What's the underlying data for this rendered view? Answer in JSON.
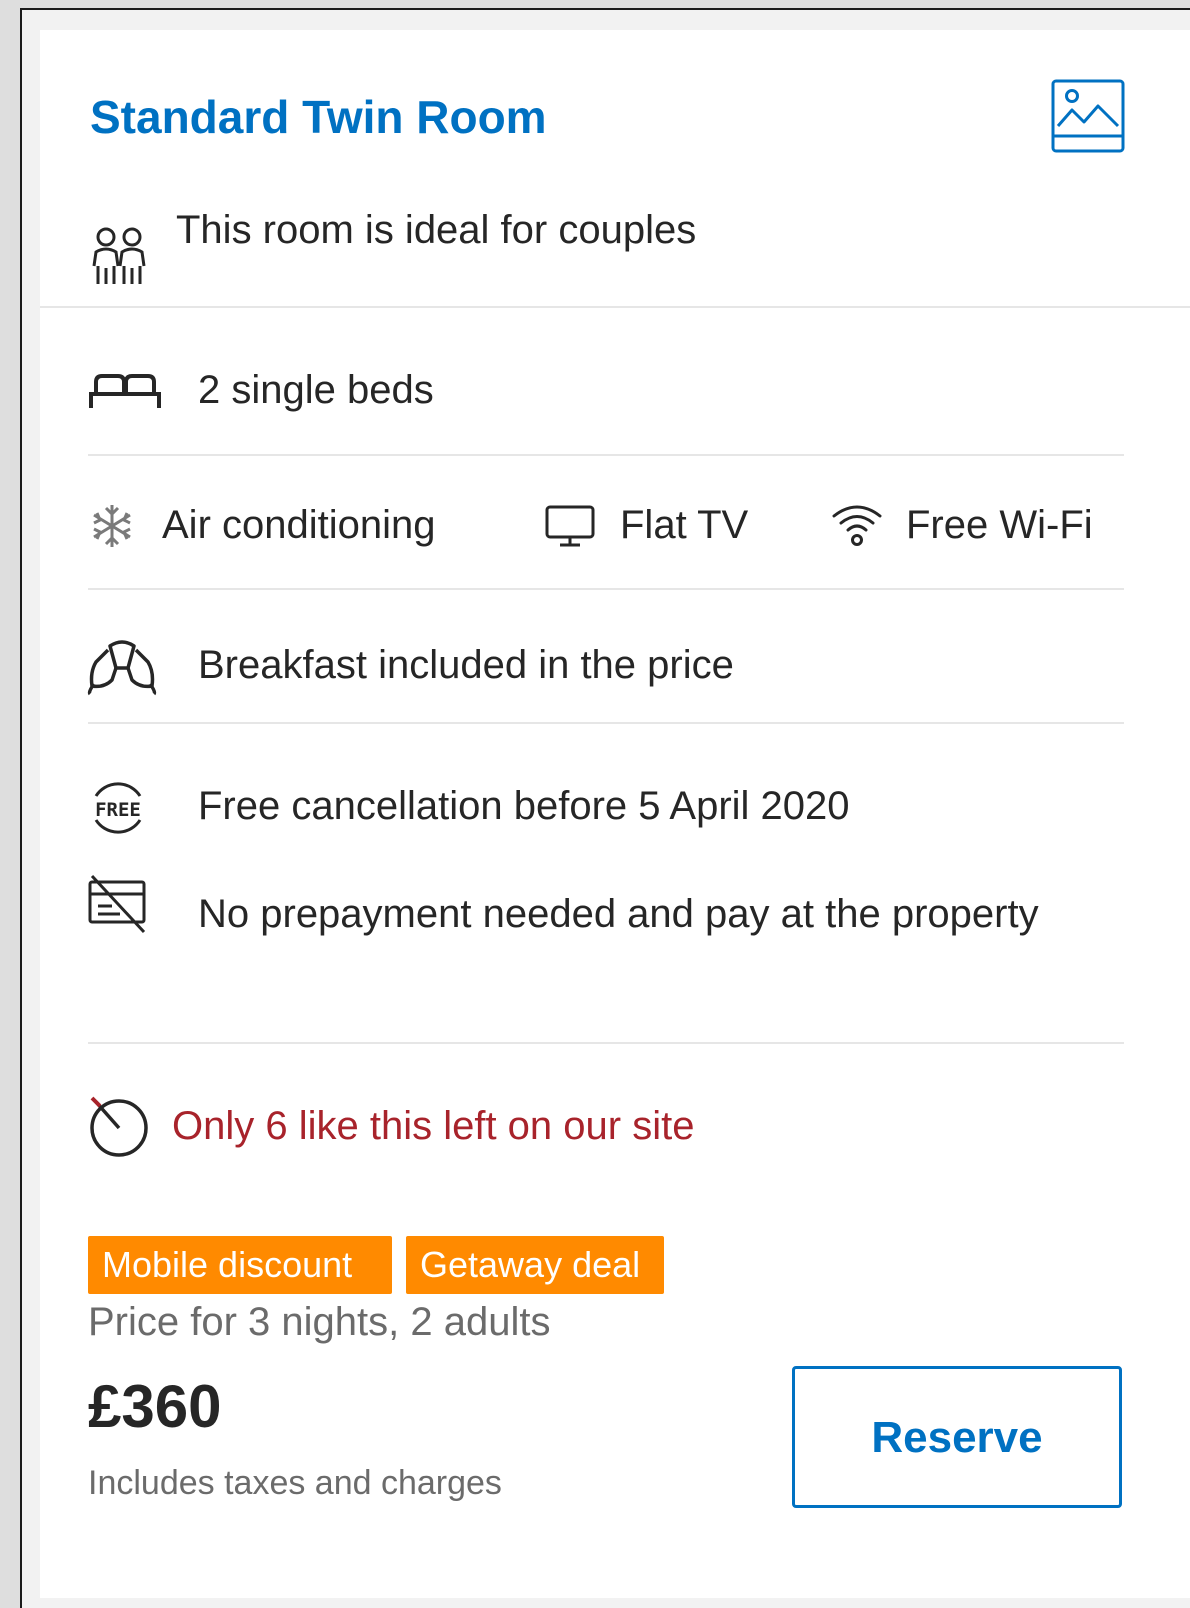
{
  "room": {
    "title": "Standard Twin Room",
    "suitability": "This room is ideal for couples",
    "beds": "2 single beds"
  },
  "facilities": [
    {
      "label": "Air conditioning",
      "icon": "snowflake-icon"
    },
    {
      "label": "Flat TV",
      "icon": "tv-icon"
    },
    {
      "label": "Free Wi-Fi",
      "icon": "wifi-icon"
    }
  ],
  "meal": {
    "label": "Breakfast included in the price",
    "icon": "croissant-icon"
  },
  "policies": {
    "cancellation": "Free cancellation before 5 April 2020",
    "cancellation_icon_text": "FREE",
    "prepayment": "No prepayment needed and pay at the property"
  },
  "availability": {
    "label": "Only 6 like this left on our site",
    "color": "#a8232b"
  },
  "badges": [
    {
      "label": "Mobile discount",
      "color": "#ff8a00"
    },
    {
      "label": "Getaway deal",
      "color": "#ff8a00"
    }
  ],
  "pricing": {
    "stay_info": "Price for 3 nights, 2 adults",
    "price": "£360",
    "note": "Includes taxes and charges"
  },
  "actions": {
    "reserve_label": "Reserve"
  },
  "colors": {
    "accent": "#0071c2",
    "badge": "#ff8a00",
    "alert": "#a8232b"
  }
}
